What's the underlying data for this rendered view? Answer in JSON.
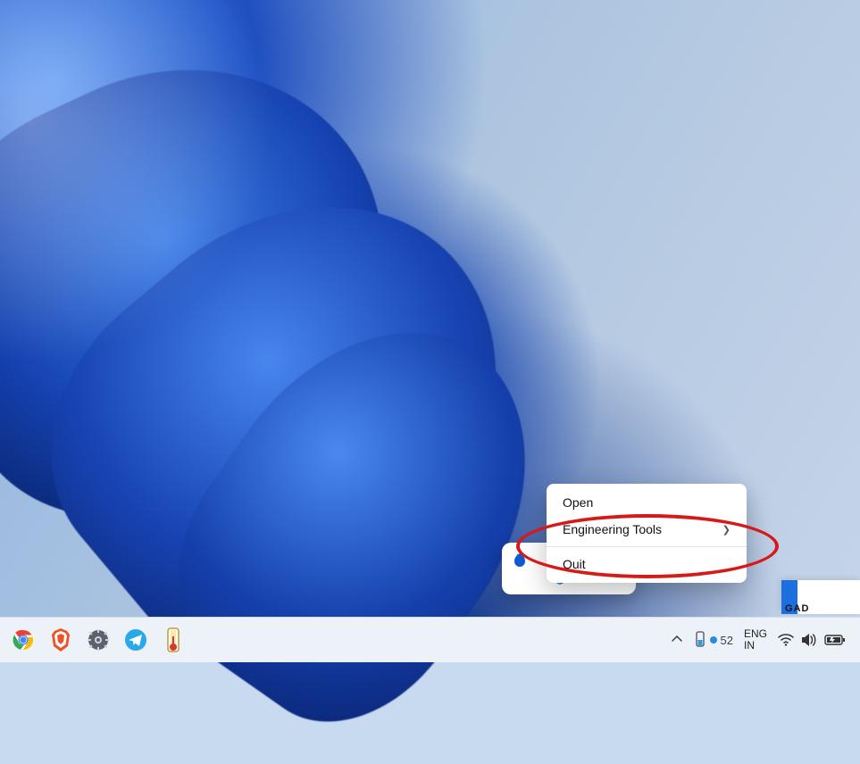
{
  "context_menu": {
    "items": [
      {
        "label": "Open",
        "has_submenu": false
      },
      {
        "label": "Engineering Tools",
        "has_submenu": true
      },
      {
        "label": "Quit",
        "has_submenu": false
      }
    ],
    "highlighted_index": 2
  },
  "tray_popup": {
    "icons": [
      "flame-icon",
      "windows-security-icon"
    ]
  },
  "taskbar": {
    "pinned": [
      {
        "name": "chrome",
        "icon": "chrome-icon"
      },
      {
        "name": "brave",
        "icon": "brave-icon"
      },
      {
        "name": "settings",
        "icon": "gear-icon"
      },
      {
        "name": "telegram",
        "icon": "telegram-icon"
      },
      {
        "name": "core-temp",
        "icon": "thermometer-icon"
      }
    ],
    "tray": {
      "overflow_chevron": "chevron-up-icon",
      "temp_value": "52",
      "language_primary": "ENG",
      "language_secondary": "IN",
      "status_icons": [
        "wifi-icon",
        "volume-icon",
        "battery-icon"
      ]
    }
  },
  "watermark": {
    "text": "GAD"
  },
  "annotation": {
    "shape": "ellipse",
    "color": "#d61a1a",
    "target_menu_item": "Quit"
  }
}
